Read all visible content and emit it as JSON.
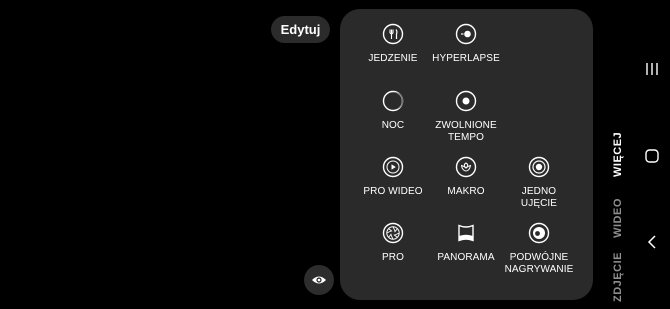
{
  "edit_button": {
    "label": "Edytuj"
  },
  "modes": [
    {
      "label": "JEDZENIE",
      "icon": "food-icon"
    },
    {
      "label": "HYPERLAPSE",
      "icon": "hyperlapse-icon"
    },
    {
      "label": "NOC",
      "icon": "night-icon"
    },
    {
      "label": "ZWOLNIONE\nTEMPO",
      "icon": "slow-motion-icon"
    },
    {
      "label": "PRO WIDEO",
      "icon": "pro-video-icon"
    },
    {
      "label": "MAKRO",
      "icon": "macro-icon"
    },
    {
      "label": "JEDNO\nUJĘCIE",
      "icon": "single-take-icon"
    },
    {
      "label": "PRO",
      "icon": "pro-icon"
    },
    {
      "label": "PANORAMA",
      "icon": "panorama-icon"
    },
    {
      "label": "PODWÓJNE\nNAGRYWANIE",
      "icon": "dual-recording-icon"
    }
  ],
  "side_tabs": {
    "more": "WIĘCEJ",
    "video": "WIDEO",
    "photo": "ZDJĘCIE"
  },
  "colors": {
    "panel": "#2a2a2a",
    "background": "#000000",
    "dim_text": "#8e8e8e"
  }
}
